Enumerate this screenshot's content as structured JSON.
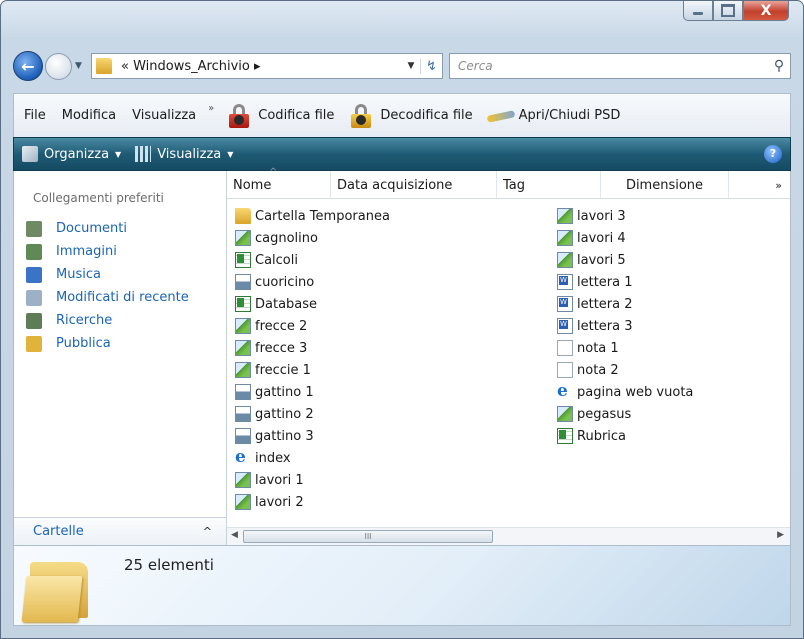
{
  "window": {
    "close_glyph": "X"
  },
  "address": {
    "back_glyph": "←",
    "crumb": "« Windows_Archivio ▸",
    "search_placeholder": "Cerca"
  },
  "menu": {
    "items": [
      "File",
      "Modifica",
      "Visualizza"
    ],
    "more": "»",
    "tools": [
      "Codifica file",
      "Decodifica file",
      "Apri/Chiudi PSD"
    ]
  },
  "commands": {
    "organize": "Organizza",
    "view": "Visualizza",
    "help": "?"
  },
  "navigation": {
    "favorites_title": "Collegamenti preferiti",
    "favorites": [
      {
        "label": "Documenti",
        "icon": "documents-icon",
        "color": "#6f8a63"
      },
      {
        "label": "Immagini",
        "icon": "pictures-icon",
        "color": "#5f8a56"
      },
      {
        "label": "Musica",
        "icon": "music-icon",
        "color": "#3b74c4"
      },
      {
        "label": "Modificati di recente",
        "icon": "recent-icon",
        "color": "#9db0c6"
      },
      {
        "label": "Ricerche",
        "icon": "searches-icon",
        "color": "#5e7d56"
      },
      {
        "label": "Pubblica",
        "icon": "public-folder-icon",
        "color": "#e0b33a"
      }
    ],
    "folders_label": "Cartelle",
    "folders_chevron": "^"
  },
  "columns": {
    "name": "Nome",
    "date": "Data acquisizione",
    "tag": "Tag",
    "size": "Dimensione",
    "more": "»"
  },
  "files": {
    "column1": [
      {
        "name": "Cartella Temporanea",
        "type": "folder"
      },
      {
        "name": "cagnolino",
        "type": "image"
      },
      {
        "name": "Calcoli",
        "type": "sheet"
      },
      {
        "name": "cuoricino",
        "type": "bmp"
      },
      {
        "name": "Database",
        "type": "sheet"
      },
      {
        "name": "frecce 2",
        "type": "image"
      },
      {
        "name": "frecce 3",
        "type": "image"
      },
      {
        "name": "freccie 1",
        "type": "image"
      },
      {
        "name": "gattino 1",
        "type": "bmp"
      },
      {
        "name": "gattino 2",
        "type": "bmp"
      },
      {
        "name": "gattino 3",
        "type": "bmp"
      },
      {
        "name": "index",
        "type": "web"
      },
      {
        "name": "lavori 1",
        "type": "image"
      },
      {
        "name": "lavori 2",
        "type": "image"
      }
    ],
    "column2": [
      {
        "name": "lavori 3",
        "type": "image"
      },
      {
        "name": "lavori 4",
        "type": "image"
      },
      {
        "name": "lavori 5",
        "type": "image"
      },
      {
        "name": "lettera 1",
        "type": "doc"
      },
      {
        "name": "lettera 2",
        "type": "doc"
      },
      {
        "name": "lettera 3",
        "type": "doc"
      },
      {
        "name": "nota 1",
        "type": "txt"
      },
      {
        "name": "nota 2",
        "type": "txt"
      },
      {
        "name": "pagina web vuota",
        "type": "web"
      },
      {
        "name": "pegasus",
        "type": "image"
      },
      {
        "name": "Rubrica",
        "type": "sheet"
      }
    ]
  },
  "scrollbar": {
    "thumb_grip": "III"
  },
  "details": {
    "count": "25 elementi"
  }
}
